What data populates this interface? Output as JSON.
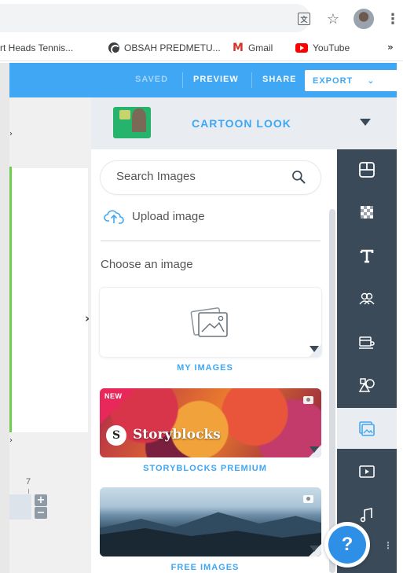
{
  "browser": {
    "bookmarks": [
      {
        "label": "rt Heads Tennis..."
      },
      {
        "label": "OBSAH PREDMETU..."
      },
      {
        "label": "Gmail"
      },
      {
        "label": "YouTube"
      }
    ],
    "more": "»"
  },
  "appbar": {
    "saved": "SAVED",
    "preview": "PREVIEW",
    "share": "SHARE",
    "export": "EXPORT"
  },
  "theme": {
    "label": "CARTOON LOOK"
  },
  "panel": {
    "search_placeholder": "Search Images",
    "upload_label": "Upload image",
    "choose_label": "Choose an image",
    "cards": [
      {
        "label": "MY IMAGES"
      },
      {
        "label": "STORYBLOCKS PREMIUM",
        "badge": "NEW",
        "brand": "Storyblocks"
      },
      {
        "label": "FREE IMAGES"
      }
    ]
  },
  "canvas": {
    "ruler_value": "7"
  },
  "toolbar": {
    "items": [
      {
        "icon": "layout-icon"
      },
      {
        "icon": "background-pattern-icon"
      },
      {
        "icon": "text-icon"
      },
      {
        "icon": "characters-icon"
      },
      {
        "icon": "props-icon"
      },
      {
        "icon": "shapes-icon"
      },
      {
        "icon": "images-icon",
        "active": true
      },
      {
        "icon": "video-icon"
      },
      {
        "icon": "music-icon"
      }
    ]
  },
  "help": {
    "label": "?"
  },
  "colors": {
    "accent": "#3fa7f4",
    "toolbar": "#3b4a59",
    "new_badge": "#e8285a"
  }
}
